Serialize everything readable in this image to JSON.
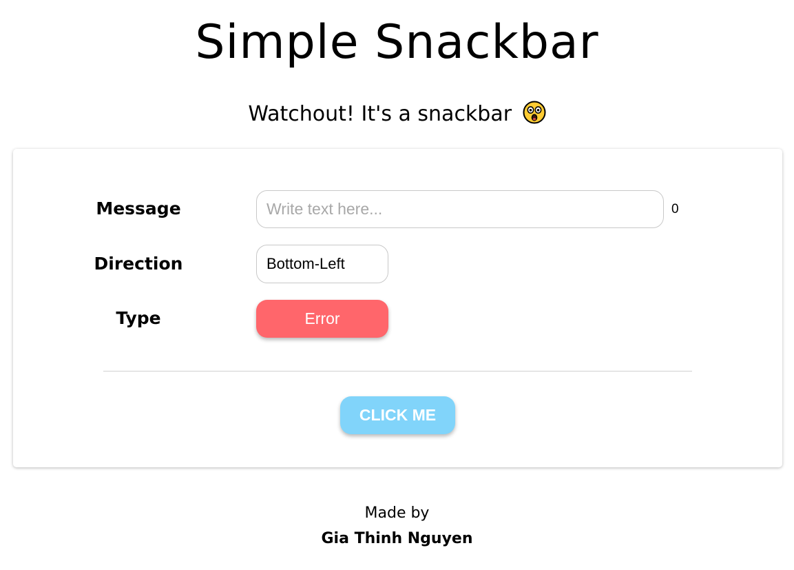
{
  "header": {
    "title": "Simple Snackbar",
    "subtitle": "Watchout! It's a snackbar",
    "subtitle_icon": "astonished-face-emoji"
  },
  "form": {
    "message_label": "Message",
    "message_placeholder": "Write text here...",
    "message_value": "",
    "message_char_count": "0",
    "direction_label": "Direction",
    "direction_value": "Bottom-Left",
    "type_label": "Type",
    "type_value": "Error",
    "type_color": "#ff666b",
    "submit_label": "CLICK ME",
    "submit_color": "#81d4fa"
  },
  "footer": {
    "made_by": "Made by",
    "author": "Gia Thinh Nguyen"
  }
}
